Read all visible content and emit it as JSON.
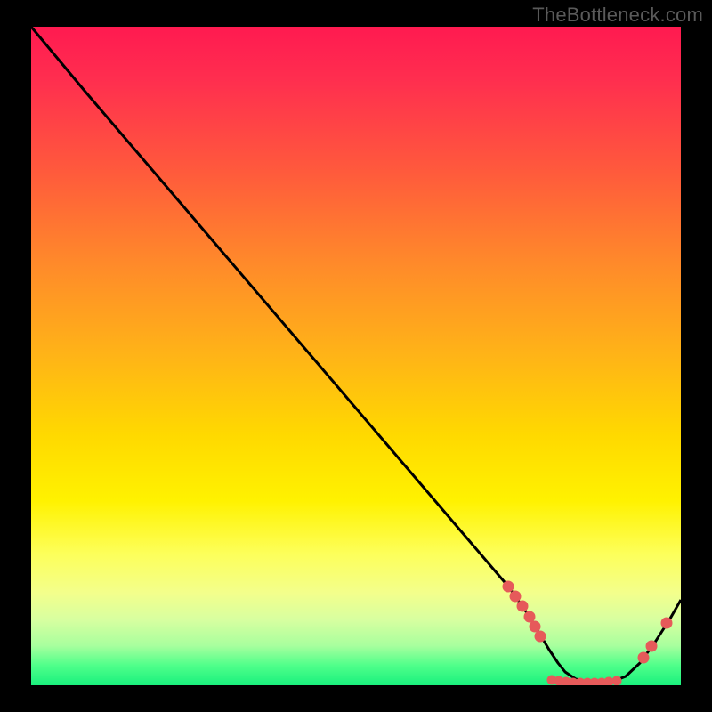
{
  "watermark": "TheBottleneck.com",
  "colors": {
    "gradient_top": "#ff1a50",
    "gradient_mid": "#ffe500",
    "gradient_bottom": "#19f07d",
    "curve": "#000000",
    "markers": "#e65a5a",
    "frame": "#000000",
    "watermark_text": "#5a5a5a"
  },
  "chart_data": {
    "type": "line",
    "title": "",
    "xlabel": "",
    "ylabel": "",
    "xlim": [
      0,
      100
    ],
    "ylim": [
      0,
      100
    ],
    "grid": false,
    "legend": false,
    "series": [
      {
        "name": "bottleneck-curve",
        "x": [
          0,
          8,
          73,
          76,
          78,
          80,
          81,
          82,
          84,
          86,
          89,
          91,
          94,
          96,
          98,
          100
        ],
        "y": [
          100,
          90,
          15,
          11,
          8,
          5.5,
          3.5,
          2,
          1,
          0.4,
          0.4,
          1.4,
          3.5,
          6.8,
          10,
          13
        ]
      }
    ],
    "markers": [
      {
        "name": "cluster-left",
        "points": [
          {
            "x": 73.4,
            "y": 15.0
          },
          {
            "x": 74.5,
            "y": 13.5
          },
          {
            "x": 75.6,
            "y": 12.0
          },
          {
            "x": 76.7,
            "y": 10.4
          },
          {
            "x": 77.5,
            "y": 8.9
          },
          {
            "x": 78.4,
            "y": 7.4
          }
        ]
      },
      {
        "name": "cluster-bottom",
        "points": [
          {
            "x": 80.1,
            "y": 0.8
          },
          {
            "x": 81.2,
            "y": 0.7
          },
          {
            "x": 82.3,
            "y": 0.5
          },
          {
            "x": 83.4,
            "y": 0.4
          },
          {
            "x": 84.5,
            "y": 0.4
          },
          {
            "x": 85.6,
            "y": 0.4
          },
          {
            "x": 86.7,
            "y": 0.4
          },
          {
            "x": 87.8,
            "y": 0.4
          },
          {
            "x": 88.9,
            "y": 0.5
          },
          {
            "x": 90.1,
            "y": 0.7
          }
        ]
      },
      {
        "name": "cluster-right",
        "points": [
          {
            "x": 94.2,
            "y": 4.2
          },
          {
            "x": 95.5,
            "y": 5.9
          },
          {
            "x": 97.8,
            "y": 9.5
          }
        ]
      }
    ]
  }
}
